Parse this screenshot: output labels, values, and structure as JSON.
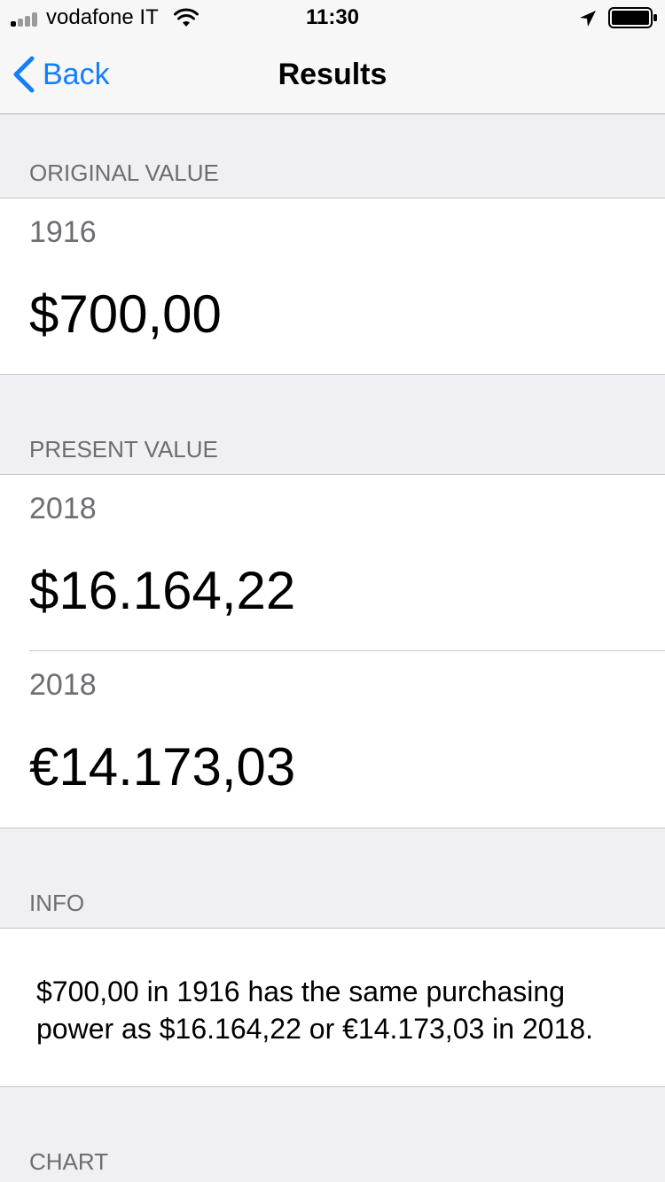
{
  "status_bar": {
    "carrier": "vodafone IT",
    "time": "11:30",
    "icons": [
      "signal-icon",
      "wifi-icon",
      "location-icon",
      "battery-icon"
    ]
  },
  "nav": {
    "back_label": "Back",
    "title": "Results",
    "accent_color": "#147efb"
  },
  "original": {
    "header": "ORIGINAL VALUE",
    "year": "1916",
    "amount": "$700,00"
  },
  "present": {
    "header": "PRESENT VALUE",
    "rows": [
      {
        "year": "2018",
        "amount": "$16.164,22"
      },
      {
        "year": "2018",
        "amount": "€14.173,03"
      }
    ]
  },
  "info": {
    "header": "INFO",
    "text": "$700,00 in 1916 has the same purchasing power as $16.164,22 or €14.173,03 in 2018."
  },
  "chart": {
    "header": "CHART"
  }
}
